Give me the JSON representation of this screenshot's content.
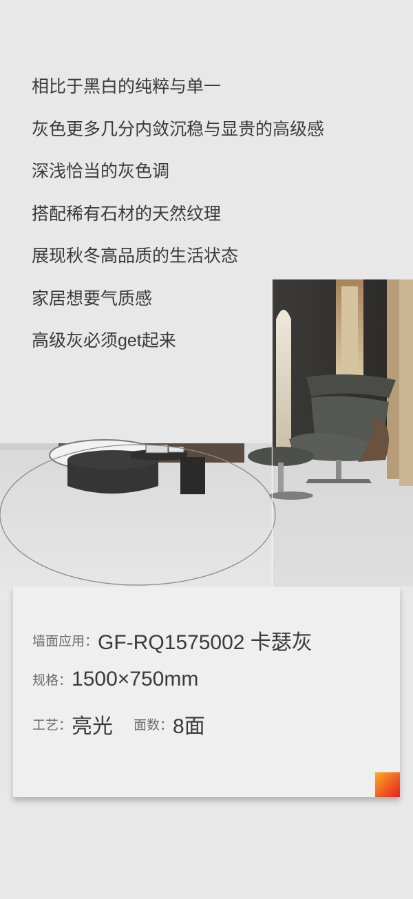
{
  "intro": {
    "lines": [
      "相比于黑白的纯粹与单一",
      "灰色更多几分内敛沉稳与显贵的高级感",
      "深浅恰当的灰色调",
      "搭配稀有石材的天然纹理",
      "展现秋冬高品质的生活状态",
      "家居想要气质感",
      "高级灰必须get起来"
    ]
  },
  "spec": {
    "wall_label": "墙面应用：",
    "wall_value": "GF-RQ1575002 卡瑟灰",
    "size_label": "规格：",
    "size_value": "1500×750mm",
    "craft_label": "工艺：",
    "craft_value": "亮光",
    "faces_label": "面数：",
    "faces_value": "8面"
  },
  "colors": {
    "background": "#e8e8e8",
    "card": "#efefef",
    "text": "#3a3a3a",
    "label": "#6b6b6b",
    "brand_gradient": [
      "#f7b21e",
      "#f36b22",
      "#e5211e"
    ]
  }
}
